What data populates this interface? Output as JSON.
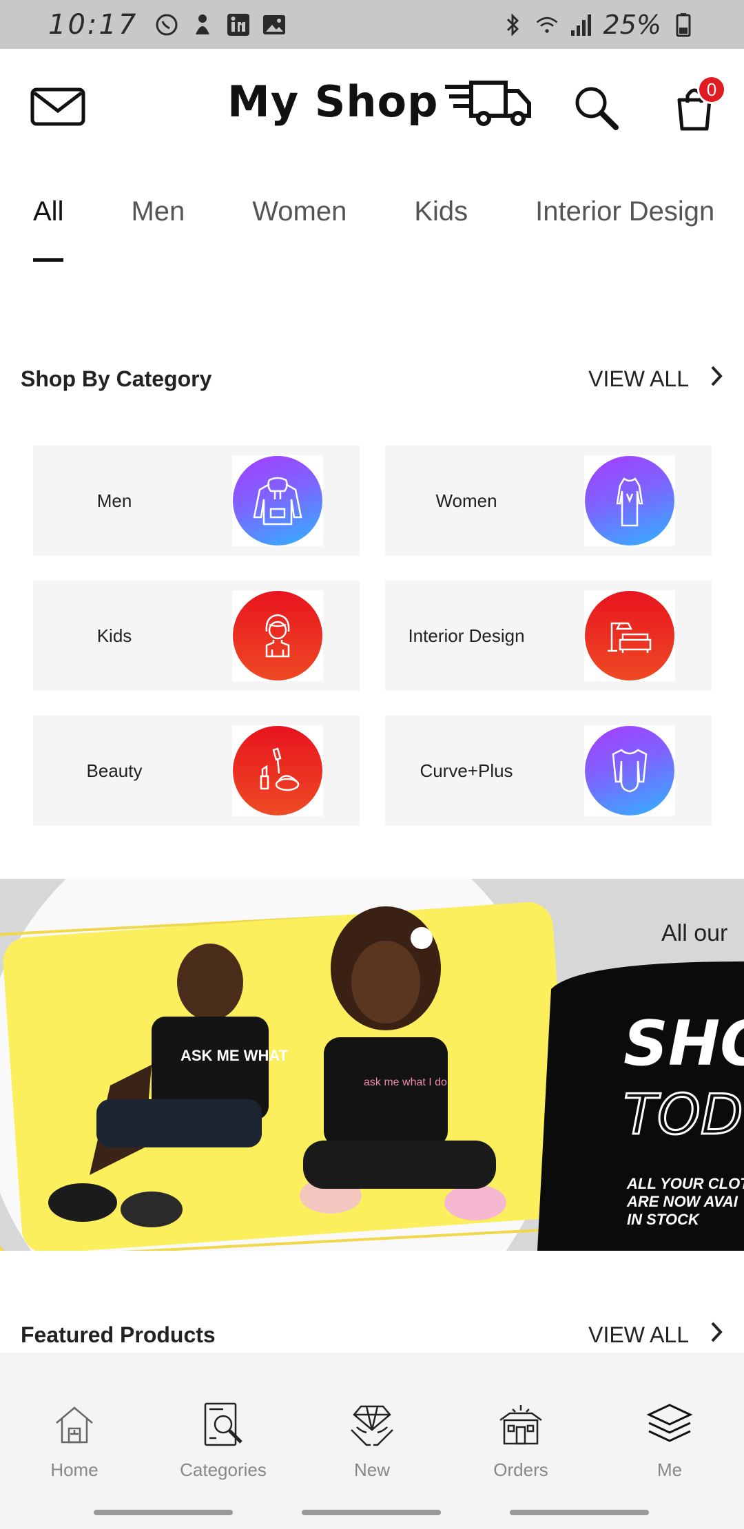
{
  "status_bar": {
    "time": "10:17",
    "battery": "25%",
    "icons": [
      "whatsapp-icon",
      "notification-icon",
      "linkedin-icon",
      "gallery-icon",
      "bluetooth-icon",
      "wifi-icon",
      "signal-icon",
      "battery-icon"
    ]
  },
  "header": {
    "title": "My Shop",
    "cart_count": "0",
    "icons": [
      "mail-icon",
      "truck-icon",
      "search-icon",
      "cart-icon"
    ]
  },
  "tabs": [
    {
      "label": "All",
      "active": true
    },
    {
      "label": "Men",
      "active": false
    },
    {
      "label": "Women",
      "active": false
    },
    {
      "label": "Kids",
      "active": false
    },
    {
      "label": "Interior Design",
      "active": false
    }
  ],
  "shop_by_category": {
    "title": "Shop By Category",
    "view_all": "VIEW ALL",
    "items": [
      {
        "label": "Men",
        "icon": "hoodie-icon",
        "color": "purple"
      },
      {
        "label": "Women",
        "icon": "dress-icon",
        "color": "purple"
      },
      {
        "label": "Kids",
        "icon": "child-icon",
        "color": "red"
      },
      {
        "label": "Interior Design",
        "icon": "sofa-lamp-icon",
        "color": "red"
      },
      {
        "label": "Beauty",
        "icon": "makeup-icon",
        "color": "red"
      },
      {
        "label": "Curve+Plus",
        "icon": "bodysuit-icon",
        "color": "purple"
      }
    ]
  },
  "banner": {
    "tagline": "All our",
    "headline_1": "SHO",
    "headline_2": "TOD",
    "subtext_1": "ALL YOUR CLOT",
    "subtext_2": "ARE NOW AVAI",
    "subtext_3": "IN STOCK",
    "shirt_text_1": "ASK ME WHAT",
    "shirt_text_2": "ask me what I do"
  },
  "featured_products": {
    "title": "Featured Products",
    "view_all": "VIEW ALL"
  },
  "bottom_nav": [
    {
      "label": "Home",
      "icon": "home-icon"
    },
    {
      "label": "Categories",
      "icon": "categories-icon"
    },
    {
      "label": "New",
      "icon": "diamond-icon"
    },
    {
      "label": "Orders",
      "icon": "orders-icon"
    },
    {
      "label": "Me",
      "icon": "layers-icon"
    }
  ],
  "colors": {
    "accent_purple": "#8a55ff",
    "accent_blue": "#2fb4ff",
    "accent_red": "#e8141e",
    "badge": "#e11b22",
    "banner_yellow": "#fbef5e"
  }
}
